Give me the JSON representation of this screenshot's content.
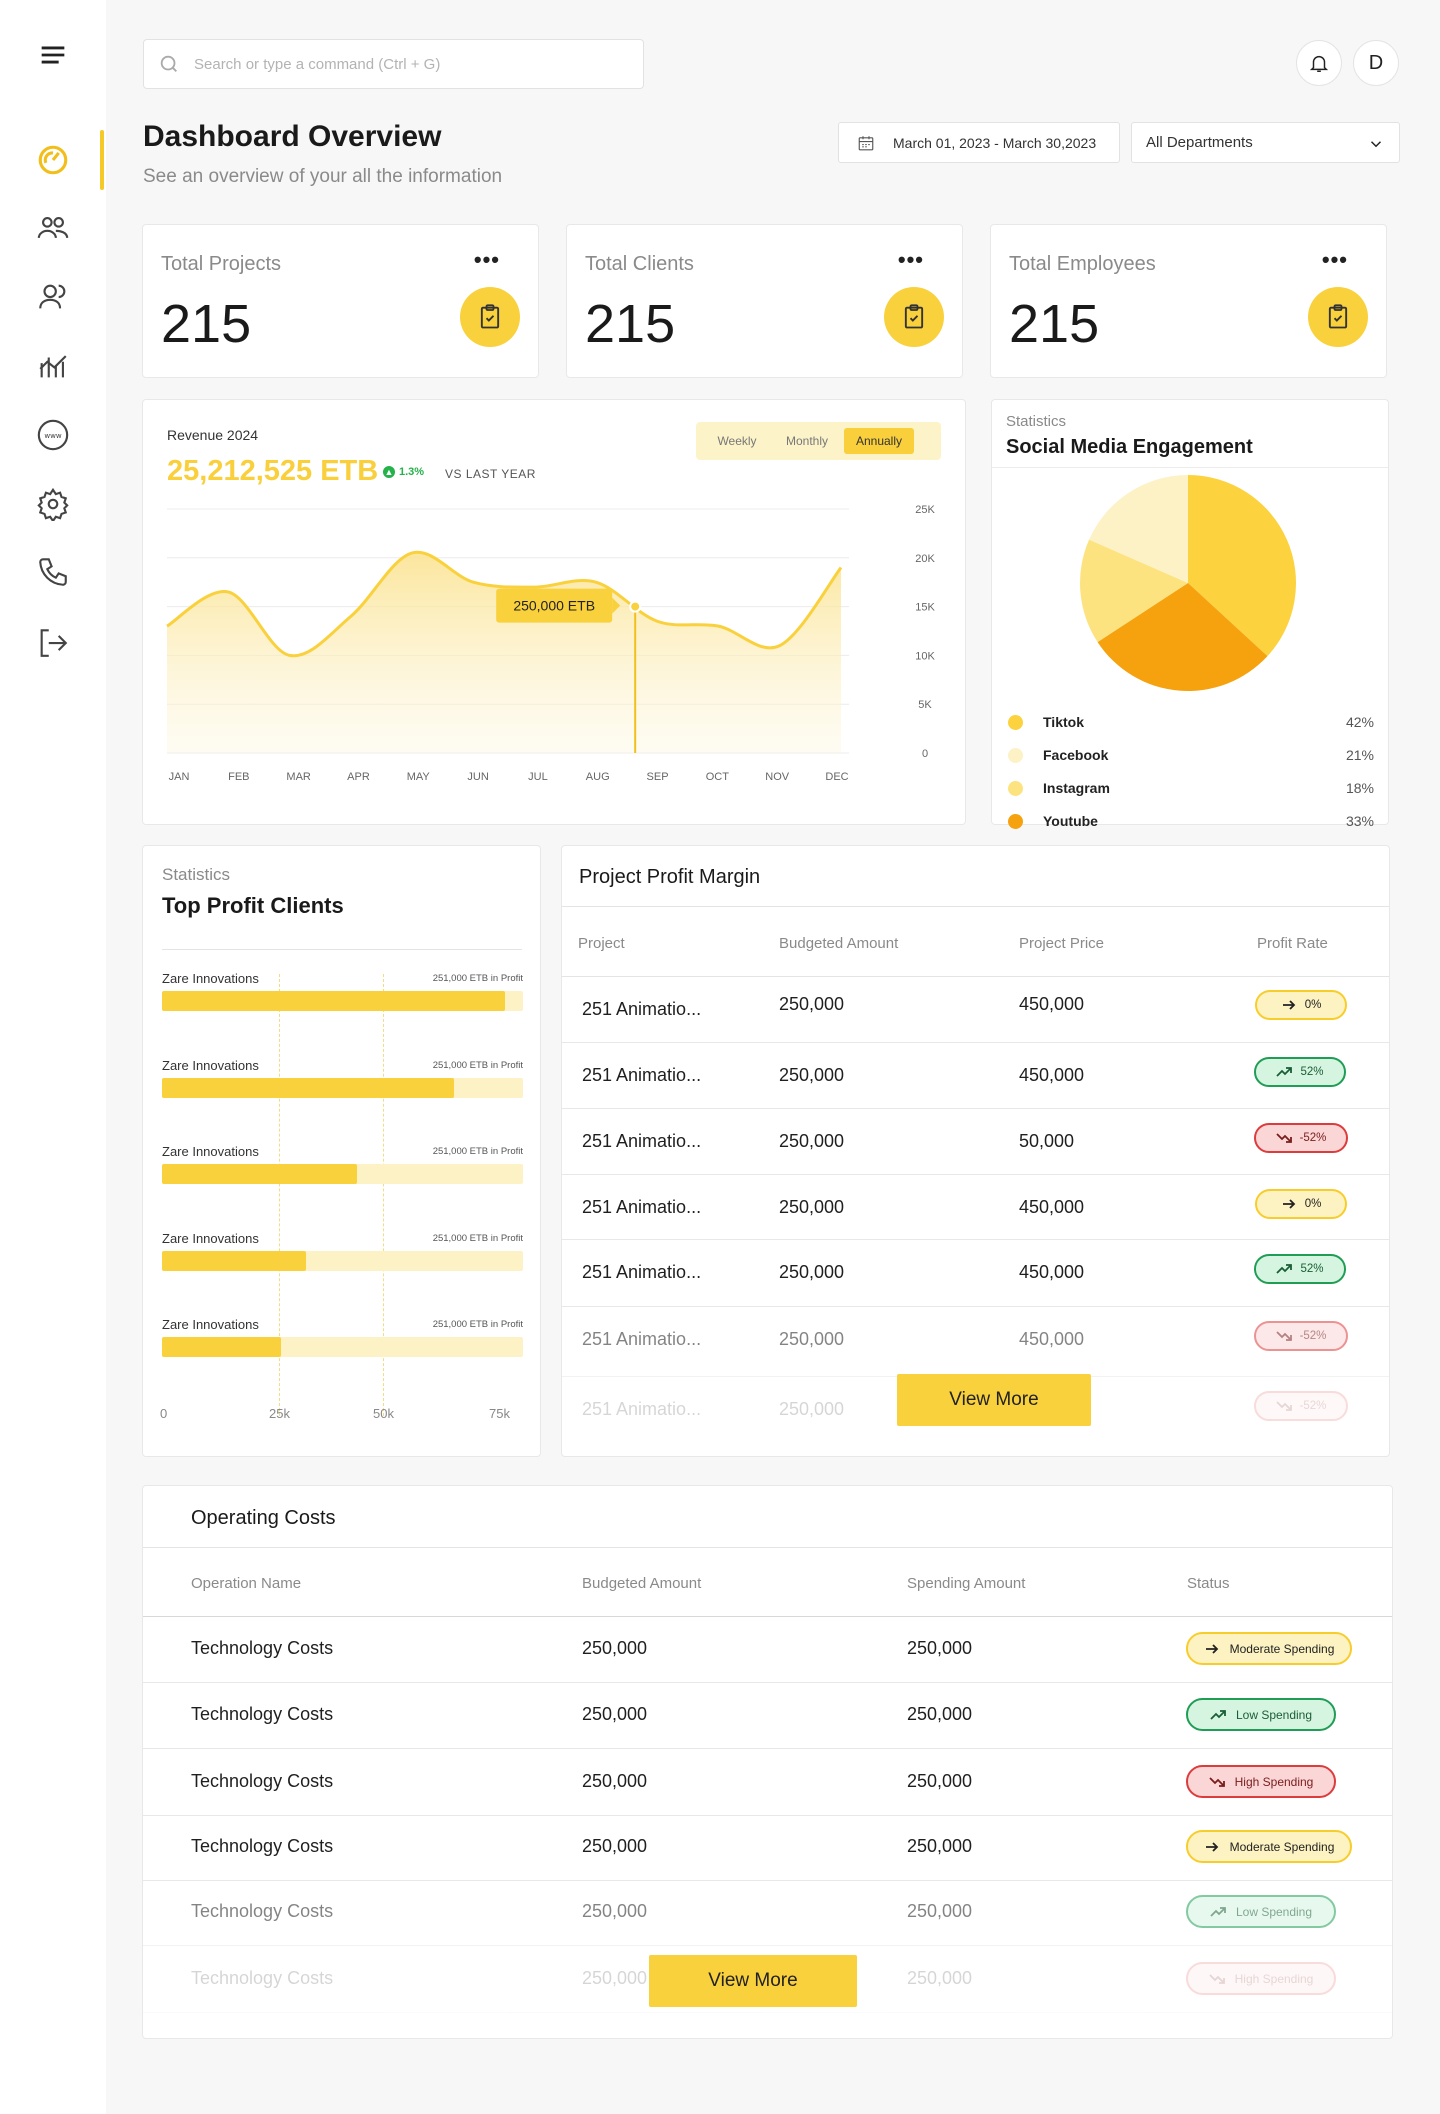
{
  "search": {
    "placeholder": "Search or type a command (Ctrl + G)"
  },
  "header": {
    "avatar_letter": "D"
  },
  "page": {
    "title": "Dashboard Overview",
    "subtitle": "See an overview of your all the information"
  },
  "filters": {
    "date_range": "March 01, 2023 - March 30,2023",
    "department": "All Departments"
  },
  "sidebar": {
    "items": [
      "menu-icon",
      "dashboard-icon",
      "clients-icon",
      "employees-icon",
      "analytics-icon",
      "website-icon",
      "settings-icon",
      "phone-icon",
      "logout-icon"
    ],
    "active": "dashboard-icon"
  },
  "stats": [
    {
      "label": "Total Projects",
      "value": "215"
    },
    {
      "label": "Total Clients",
      "value": "215"
    },
    {
      "label": "Total Employees",
      "value": "215"
    }
  ],
  "revenue": {
    "title": "Revenue 2024",
    "amount": "25,212,525 ETB",
    "change": "1.3%",
    "vs_label": "VS LAST YEAR",
    "periods": [
      "Weekly",
      "Monthly",
      "Annually"
    ],
    "active_period": "Annually",
    "tooltip": "250,000 ETB"
  },
  "chart_data": {
    "type": "area",
    "x": [
      "JAN",
      "FEB",
      "MAR",
      "APR",
      "MAY",
      "JUN",
      "JUL",
      "AUG",
      "SEP",
      "OCT",
      "NOV",
      "DEC"
    ],
    "values": [
      13000,
      16500,
      10000,
      14000,
      20500,
      17500,
      17000,
      17500,
      13500,
      13000,
      11000,
      19000
    ],
    "yticks": [
      "25K",
      "20K",
      "15K",
      "10K",
      "5K",
      "0"
    ],
    "ylim": [
      0,
      25000
    ],
    "highlight": {
      "x": "SEP",
      "label": "250,000 ETB"
    },
    "color": "#f9d13c"
  },
  "social": {
    "label": "Statistics",
    "title": "Social Media Engagement",
    "items": [
      {
        "name": "Tiktok",
        "value": "42%",
        "color": "#fcd23f"
      },
      {
        "name": "Facebook",
        "value": "21%",
        "color": "#fdf1c6"
      },
      {
        "name": "Instagram",
        "value": "18%",
        "color": "#fde37f"
      },
      {
        "name": "Youtube",
        "value": "33%",
        "color": "#f5a20e"
      }
    ]
  },
  "top_clients": {
    "label": "Statistics",
    "title": "Top Profit Clients",
    "axis": [
      "0",
      "25k",
      "50k",
      "75k"
    ],
    "rows": [
      {
        "name": "Zare Innovations",
        "amount": "251,000 ETB in Profit",
        "fraction": 0.95
      },
      {
        "name": "Zare Innovations",
        "amount": "251,000 ETB in Profit",
        "fraction": 0.81
      },
      {
        "name": "Zare Innovations",
        "amount": "251,000 ETB in Profit",
        "fraction": 0.54
      },
      {
        "name": "Zare Innovations",
        "amount": "251,000 ETB in Profit",
        "fraction": 0.4
      },
      {
        "name": "Zare Innovations",
        "amount": "251,000 ETB in Profit",
        "fraction": 0.33
      }
    ]
  },
  "profit_margin": {
    "title": "Project Profit Margin",
    "columns": [
      "Project",
      "Budgeted Amount",
      "Project Price",
      "Profit Rate"
    ],
    "rows": [
      {
        "project": "251 Animatio...",
        "budget": "250,000",
        "price": "450,000",
        "rate": "0%",
        "trend": "neutral"
      },
      {
        "project": "251 Animatio...",
        "budget": "250,000",
        "price": "450,000",
        "rate": "52%",
        "trend": "up"
      },
      {
        "project": "251 Animatio...",
        "budget": "250,000",
        "price": "50,000",
        "rate": "-52%",
        "trend": "down"
      },
      {
        "project": "251 Animatio...",
        "budget": "250,000",
        "price": "450,000",
        "rate": "0%",
        "trend": "neutral"
      },
      {
        "project": "251 Animatio...",
        "budget": "250,000",
        "price": "450,000",
        "rate": "52%",
        "trend": "up"
      },
      {
        "project": "251 Animatio...",
        "budget": "250,000",
        "price": "450,000",
        "rate": "-52%",
        "trend": "down"
      },
      {
        "project": "251 Animatio...",
        "budget": "250,000",
        "price": "",
        "rate": "-52%",
        "trend": "down"
      }
    ],
    "view_more": "View More"
  },
  "operating_costs": {
    "title": "Operating Costs",
    "columns": [
      "Operation Name",
      "Budgeted Amount",
      "Spending Amount",
      "Status"
    ],
    "rows": [
      {
        "name": "Technology Costs",
        "budget": "250,000",
        "spending": "250,000",
        "status": "Moderate Spending",
        "trend": "neutral"
      },
      {
        "name": "Technology Costs",
        "budget": "250,000",
        "spending": "250,000",
        "status": "Low Spending",
        "trend": "up"
      },
      {
        "name": "Technology Costs",
        "budget": "250,000",
        "spending": "250,000",
        "status": "High Spending",
        "trend": "down"
      },
      {
        "name": "Technology Costs",
        "budget": "250,000",
        "spending": "250,000",
        "status": "Moderate Spending",
        "trend": "neutral"
      },
      {
        "name": "Technology Costs",
        "budget": "250,000",
        "spending": "250,000",
        "status": "Low Spending",
        "trend": "up"
      },
      {
        "name": "Technology Costs",
        "budget": "250,000",
        "spending": "250,000",
        "status": "High Spending",
        "trend": "down"
      }
    ],
    "view_more": "View More"
  }
}
